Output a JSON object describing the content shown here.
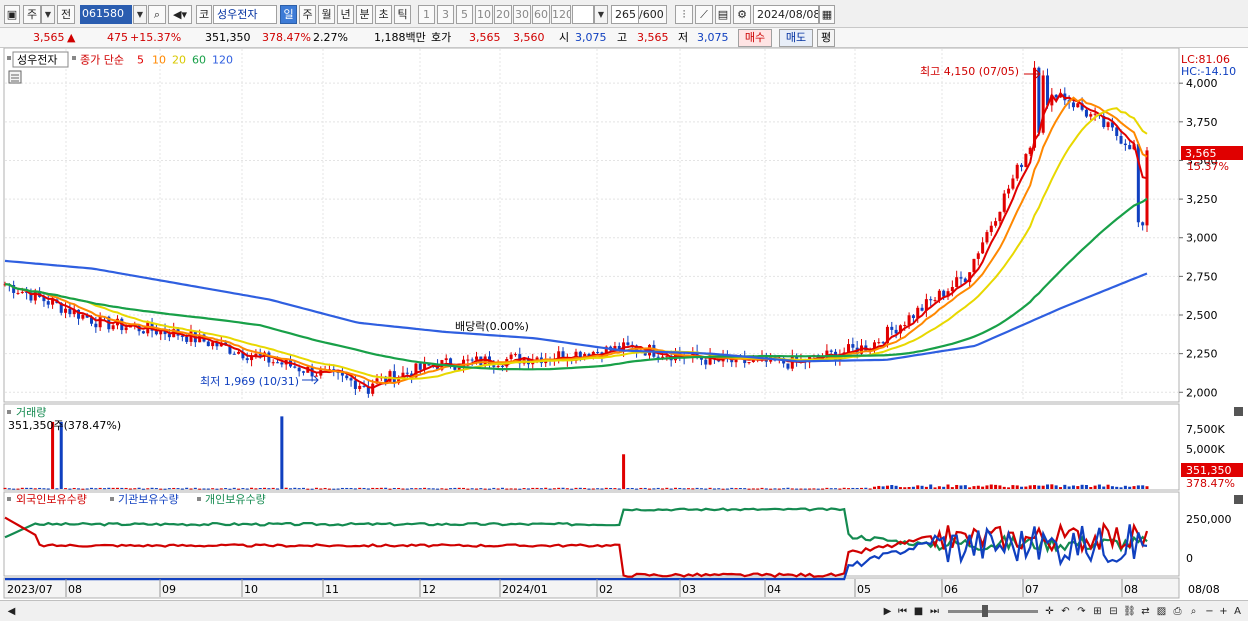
{
  "toolbar": {
    "market": "주",
    "prev_label": "전",
    "code": "061580",
    "stock_type": "코",
    "stock_name": "성우전자",
    "periods": [
      "일",
      "주",
      "월",
      "년",
      "분",
      "초",
      "틱"
    ],
    "selected_period": "일",
    "intervals": [
      "1",
      "3",
      "5",
      "10",
      "20",
      "30",
      "60",
      "120"
    ],
    "count": "265",
    "count_total": "/600",
    "date": "2024/08/08"
  },
  "info": {
    "price": "3,565",
    "change": "475",
    "change_pct": "+15.37%",
    "volume": "351,350",
    "volume_pct": "378.47%",
    "turnover": "2.27%",
    "amount": "1,188백만",
    "quote_label": "호가",
    "ask": "3,565",
    "bid": "3,560",
    "open_label": "시",
    "open": "3,075",
    "high_label": "고",
    "high": "3,565",
    "low_label": "저",
    "low": "3,075",
    "buy_btn": "매수",
    "sell_btn": "매도",
    "eval_btn": "평"
  },
  "price_panel": {
    "stock_tag": "성우전자",
    "legend_title": "종가 단순",
    "ma": [
      {
        "period": "5",
        "color": "#e00000"
      },
      {
        "period": "10",
        "color": "#ff8800"
      },
      {
        "period": "20",
        "color": "#e8d800"
      },
      {
        "period": "60",
        "color": "#18a048"
      },
      {
        "period": "120",
        "color": "#2f5fe0"
      }
    ],
    "lc": "LC:81.06",
    "hc": "HC:-14.10",
    "max_annotation": "최고 4,150 (07/05)",
    "min_annotation": "최저 1,969 (10/31)",
    "dividend_annotation": "배당락(0.00%)",
    "current_price_tag": "3,565",
    "current_pct_tag": "15.37%",
    "y_ticks": [
      "4,000",
      "3,750",
      "3,500",
      "3,250",
      "3,000",
      "2,750",
      "2,500",
      "2,250",
      "2,000"
    ]
  },
  "volume_panel": {
    "title": "거래량",
    "subtitle": "351,350주(378.47%)",
    "y_ticks": [
      "7,500K",
      "5,000K"
    ],
    "current_tag": "351,350",
    "current_pct": "378.47%"
  },
  "holding_panel": {
    "legend": [
      {
        "name": "외국인보유수량",
        "color": "#d00000"
      },
      {
        "name": "기관보유수량",
        "color": "#1040c0"
      },
      {
        "name": "개인보유수량",
        "color": "#148a50"
      }
    ],
    "y_ticks": [
      "250,000",
      "0"
    ]
  },
  "x_axis": {
    "labels": [
      "2023/07",
      "08",
      "09",
      "10",
      "11",
      "12",
      "2024/01",
      "02",
      "03",
      "04",
      "05",
      "06",
      "07",
      "08"
    ],
    "right_label": "08/08"
  },
  "chart_data": {
    "type": "line",
    "title": "성우전자 일봉",
    "x": [
      "2023/07",
      "08",
      "09",
      "10",
      "11",
      "12",
      "2024/01",
      "02",
      "03",
      "04",
      "05",
      "06",
      "07",
      "08"
    ],
    "series": [
      {
        "name": "종가",
        "values": [
          2700,
          2450,
          2380,
          2200,
          2050,
          2180,
          2230,
          2290,
          2200,
          2190,
          2300,
          2750,
          3950,
          3565
        ]
      },
      {
        "name": "120",
        "values": [
          2850,
          2800,
          2700,
          2600,
          2450,
          2390,
          2350,
          2270,
          2250,
          2200,
          2210,
          2300,
          2550,
          2780
        ]
      }
    ],
    "y_range": [
      1950,
      4150
    ],
    "max": {
      "value": 4150,
      "date": "07/05"
    },
    "min": {
      "value": 1969,
      "date": "10/31"
    },
    "current": 3565
  }
}
